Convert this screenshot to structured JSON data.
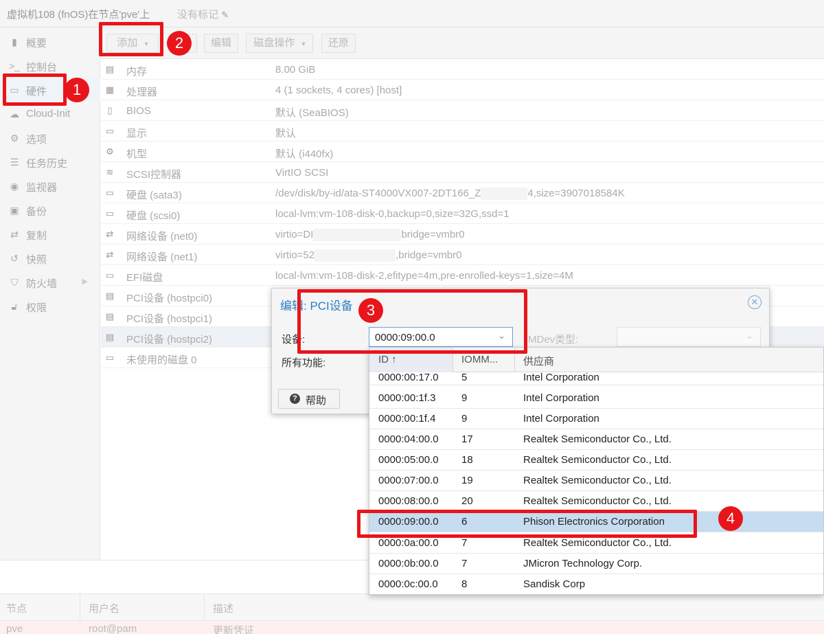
{
  "header": {
    "title": "虚拟机108 (fnOS)在节点'pve'上",
    "tags": "没有标记"
  },
  "sidebar": {
    "items": [
      {
        "label": "概要",
        "icon": "book-icon"
      },
      {
        "label": "控制台",
        "icon": "terminal-icon"
      },
      {
        "label": "硬件",
        "icon": "monitor-icon"
      },
      {
        "label": "Cloud-Init",
        "icon": "cloud-icon"
      },
      {
        "label": "选项",
        "icon": "gear-icon"
      },
      {
        "label": "任务历史",
        "icon": "list-icon"
      },
      {
        "label": "监视器",
        "icon": "eye-icon"
      },
      {
        "label": "备份",
        "icon": "floppy-icon"
      },
      {
        "label": "复制",
        "icon": "retweet-icon"
      },
      {
        "label": "快照",
        "icon": "history-icon"
      },
      {
        "label": "防火墙",
        "icon": "shield-icon"
      },
      {
        "label": "权限",
        "icon": "unlock-icon"
      }
    ]
  },
  "toolbar": {
    "add": "添加",
    "remove": "",
    "edit": "编辑",
    "disk_action": "磁盘操作",
    "revert": "还原"
  },
  "hardware": [
    {
      "key": "内存",
      "value": "8.00 GiB",
      "icon": "memory-icon"
    },
    {
      "key": "处理器",
      "value": "4 (1 sockets, 4 cores) [host]",
      "icon": "cpu-icon"
    },
    {
      "key": "BIOS",
      "value": "默认 (SeaBIOS)",
      "icon": "bios-icon"
    },
    {
      "key": "显示",
      "value": "默认",
      "icon": "display-icon"
    },
    {
      "key": "机型",
      "value": "默认 (i440fx)",
      "icon": "cogs-icon"
    },
    {
      "key": "SCSI控制器",
      "value": "VirtIO SCSI",
      "icon": "database-icon"
    },
    {
      "key": "硬盘 (sata3)",
      "value_a": "/dev/disk/by-id/ata-ST4000VX007-2DT166_Z",
      "value_b": "4,size=3907018584K",
      "icon": "hdd-icon"
    },
    {
      "key": "硬盘 (scsi0)",
      "value": "local-lvm:vm-108-disk-0,backup=0,size=32G,ssd=1",
      "icon": "hdd-icon"
    },
    {
      "key": "网络设备 (net0)",
      "value_a": "virtio=DI",
      "value_b": "bridge=vmbr0",
      "icon": "exchange-icon"
    },
    {
      "key": "网络设备 (net1)",
      "value_a": "virtio=52",
      "value_b": ",bridge=vmbr0",
      "icon": "exchange-icon"
    },
    {
      "key": "EFI磁盘",
      "value": "local-lvm:vm-108-disk-2,efitype=4m,pre-enrolled-keys=1,size=4M",
      "icon": "hdd-icon"
    },
    {
      "key": "PCI设备 (hostpci0)",
      "value": "",
      "icon": "pci-icon"
    },
    {
      "key": "PCI设备 (hostpci1)",
      "value": "",
      "icon": "pci-icon"
    },
    {
      "key": "PCI设备 (hostpci2)",
      "value": "",
      "icon": "pci-icon"
    },
    {
      "key": "未使用的磁盘 0",
      "value": "",
      "icon": "hdd-icon"
    }
  ],
  "dialog": {
    "title": "编辑: PCI设备",
    "device_label": "设备:",
    "device_value": "0000:09:00.0",
    "all_functions_label": "所有功能:",
    "mdev_label": "MDev类型:",
    "help_label": "帮助"
  },
  "device_list": {
    "columns": [
      "ID ↑",
      "IOMM...",
      "供应商"
    ],
    "rows": [
      {
        "id": "0000:00:17.0",
        "iommu": "5",
        "vendor": "Intel Corporation"
      },
      {
        "id": "0000:00:1f.3",
        "iommu": "9",
        "vendor": "Intel Corporation"
      },
      {
        "id": "0000:00:1f.4",
        "iommu": "9",
        "vendor": "Intel Corporation"
      },
      {
        "id": "0000:04:00.0",
        "iommu": "17",
        "vendor": "Realtek Semiconductor Co., Ltd."
      },
      {
        "id": "0000:05:00.0",
        "iommu": "18",
        "vendor": "Realtek Semiconductor Co., Ltd."
      },
      {
        "id": "0000:07:00.0",
        "iommu": "19",
        "vendor": "Realtek Semiconductor Co., Ltd."
      },
      {
        "id": "0000:08:00.0",
        "iommu": "20",
        "vendor": "Realtek Semiconductor Co., Ltd."
      },
      {
        "id": "0000:09:00.0",
        "iommu": "6",
        "vendor": "Phison Electronics Corporation"
      },
      {
        "id": "0000:0a:00.0",
        "iommu": "7",
        "vendor": "Realtek Semiconductor Co., Ltd."
      },
      {
        "id": "0000:0b:00.0",
        "iommu": "7",
        "vendor": "JMicron Technology Corp."
      },
      {
        "id": "0000:0c:00.0",
        "iommu": "8",
        "vendor": "Sandisk Corp"
      }
    ],
    "selected_id": "0000:09:00.0"
  },
  "tasks": {
    "columns": [
      "节点",
      "用户名",
      "描述"
    ],
    "row": {
      "node": "pve",
      "user": "root@pam",
      "desc": "更新凭证"
    }
  },
  "annotations": {
    "labels": [
      "1",
      "2",
      "3",
      "4"
    ],
    "color": "#e8151b"
  }
}
